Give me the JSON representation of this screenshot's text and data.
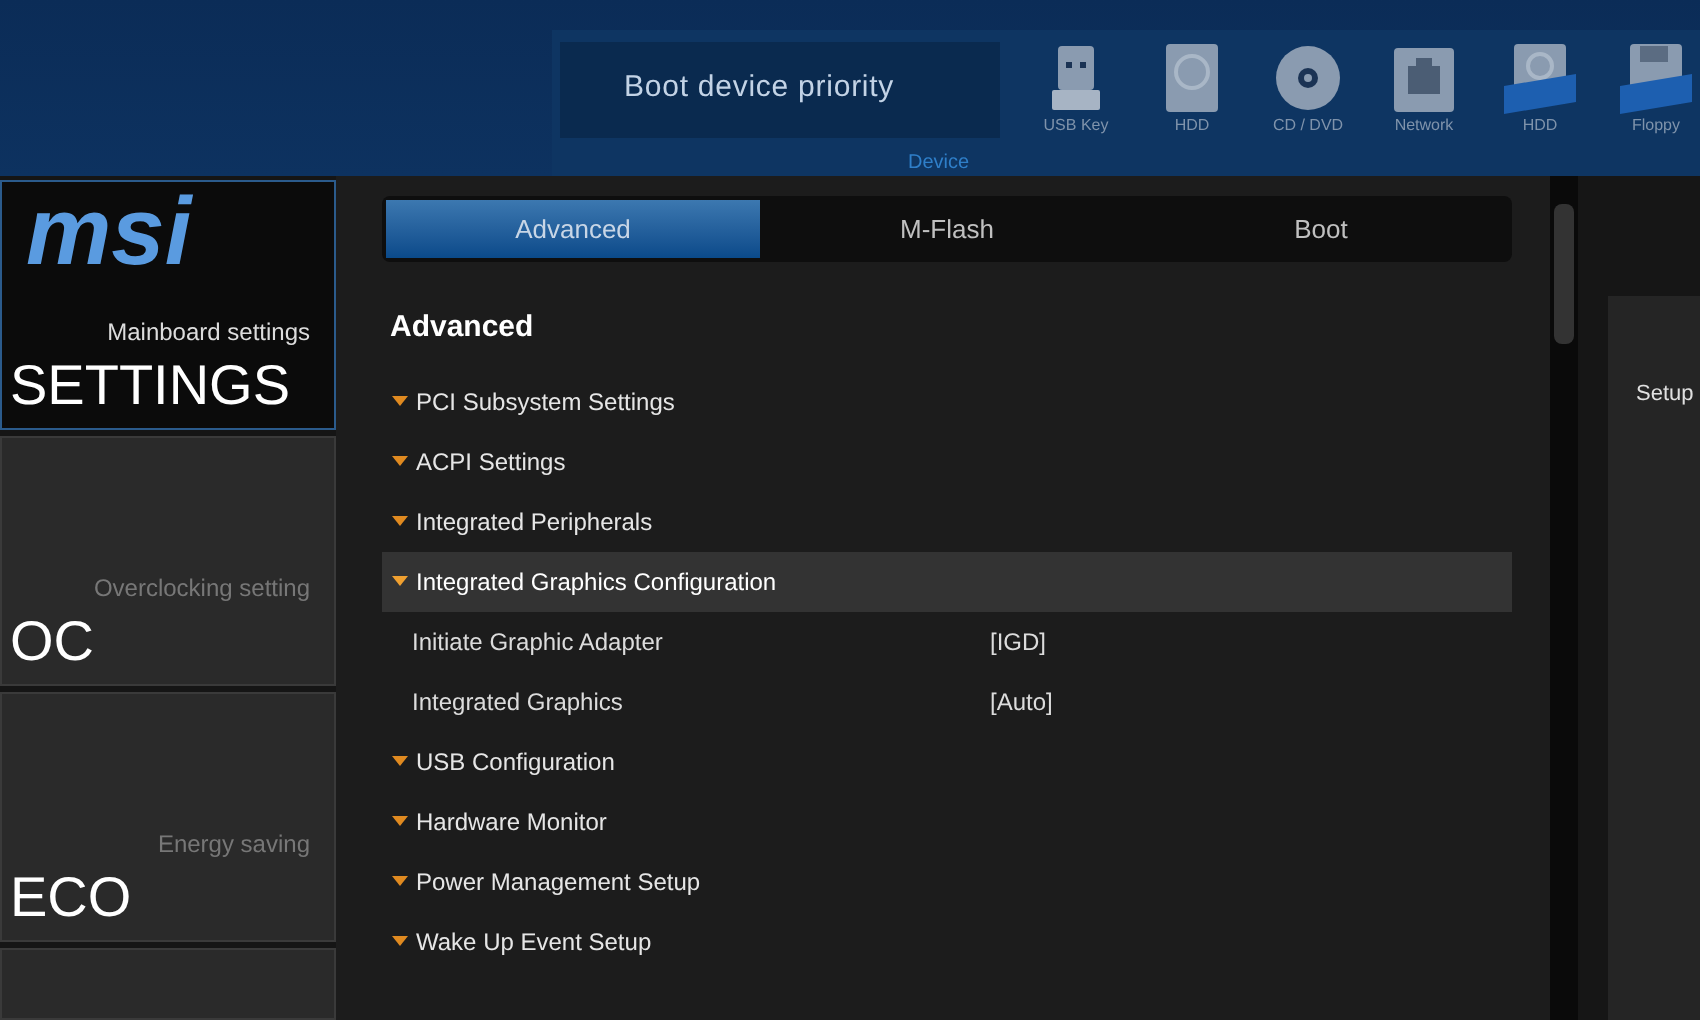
{
  "boot_bar": {
    "title": "Boot device priority",
    "devices": [
      {
        "label": "USB Key",
        "kind": "usb-key"
      },
      {
        "label": "HDD",
        "kind": "hdd"
      },
      {
        "label": "CD / DVD",
        "kind": "disc"
      },
      {
        "label": "Network",
        "kind": "network"
      },
      {
        "label": "HDD",
        "kind": "usb-hdd"
      },
      {
        "label": "Floppy",
        "kind": "usb-floppy"
      }
    ],
    "caption": "Device"
  },
  "sidebar": {
    "logo": "msi",
    "items": [
      {
        "subtitle": "Mainboard settings",
        "title": "SETTINGS",
        "selected": true
      },
      {
        "subtitle": "Overclocking setting",
        "title": "OC",
        "selected": false
      },
      {
        "subtitle": "Energy saving",
        "title": "ECO",
        "selected": false
      }
    ]
  },
  "tabs": [
    {
      "label": "Advanced",
      "selected": true
    },
    {
      "label": "M-Flash",
      "selected": false
    },
    {
      "label": "Boot",
      "selected": false
    }
  ],
  "heading": "Advanced",
  "menu": [
    {
      "label": "PCI Subsystem Settings",
      "selected": false,
      "expanded": false
    },
    {
      "label": "ACPI Settings",
      "selected": false,
      "expanded": false
    },
    {
      "label": "Integrated Peripherals",
      "selected": false,
      "expanded": false
    },
    {
      "label": "Integrated Graphics Configuration",
      "selected": true,
      "expanded": true,
      "children": [
        {
          "label": "Initiate Graphic Adapter",
          "value": "[IGD]"
        },
        {
          "label": "Integrated Graphics",
          "value": "[Auto]"
        }
      ]
    },
    {
      "label": "USB Configuration",
      "selected": false,
      "expanded": false
    },
    {
      "label": "Hardware Monitor",
      "selected": false,
      "expanded": false
    },
    {
      "label": "Power Management Setup",
      "selected": false,
      "expanded": false
    },
    {
      "label": "Wake Up Event Setup",
      "selected": false,
      "expanded": false
    }
  ],
  "help_panel": {
    "text": "Setup"
  }
}
